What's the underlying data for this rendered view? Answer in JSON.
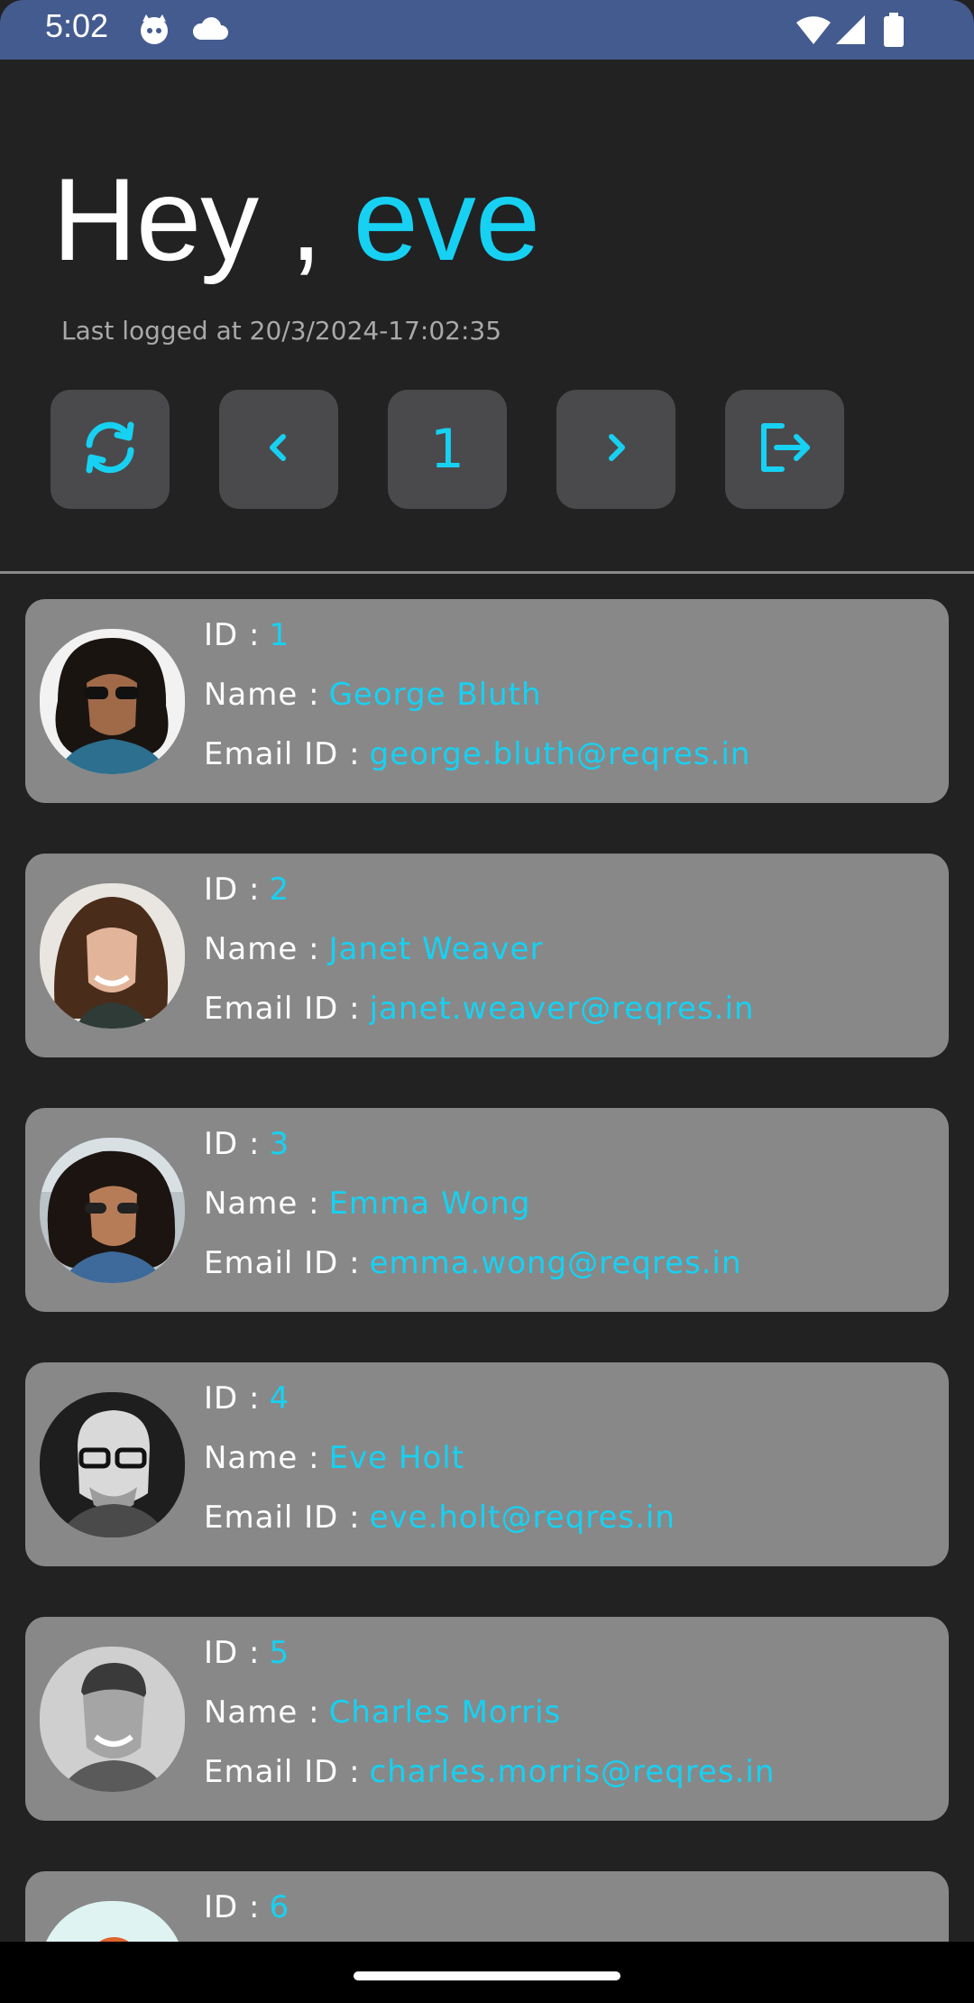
{
  "status_bar": {
    "time": "5:02"
  },
  "header": {
    "greeting_prefix": "Hey ,",
    "username": "eve",
    "last_logged_label": "Last logged at",
    "last_logged_value": "20/3/2024-17:02:35"
  },
  "toolbar": {
    "page_number": "1",
    "icons": [
      "refresh-icon",
      "chevron-left-icon",
      "chevron-right-icon",
      "logout-icon"
    ]
  },
  "labels": {
    "id": "ID :",
    "name": "Name :",
    "email": "Email ID :"
  },
  "users": [
    {
      "id": "1",
      "name": "George Bluth",
      "email": "george.bluth@reqres.in"
    },
    {
      "id": "2",
      "name": "Janet Weaver",
      "email": "janet.weaver@reqres.in"
    },
    {
      "id": "3",
      "name": "Emma Wong",
      "email": "emma.wong@reqres.in"
    },
    {
      "id": "4",
      "name": "Eve Holt",
      "email": "eve.holt@reqres.in"
    },
    {
      "id": "5",
      "name": "Charles Morris",
      "email": "charles.morris@reqres.in"
    },
    {
      "id": "6",
      "name": "",
      "email": ""
    }
  ],
  "colors": {
    "accent": "#17d1f2",
    "background": "#222223",
    "card": "#888888",
    "button": "#4a4a4c",
    "status_bar": "#445b8f"
  }
}
